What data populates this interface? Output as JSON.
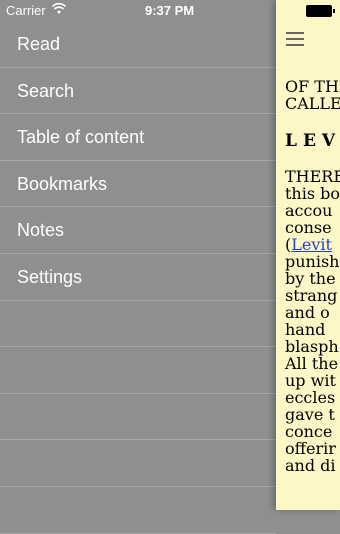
{
  "status_bar": {
    "carrier": "Carrier",
    "time": "9:37 PM",
    "wifi_icon": "wifi-icon",
    "battery_icon": "battery-icon"
  },
  "menu": {
    "items": [
      {
        "label": "Read"
      },
      {
        "label": "Search"
      },
      {
        "label": "Table of content"
      },
      {
        "label": "Bookmarks"
      },
      {
        "label": "Notes"
      },
      {
        "label": "Settings"
      }
    ]
  },
  "reader": {
    "menu_icon": "hamburger-menu-icon",
    "heading_lines": [
      "OF THE",
      "CALLE"
    ],
    "chapter": "LEV",
    "body_lines": [
      {
        "text": "THERE"
      },
      {
        "text": "this bo"
      },
      {
        "text": "accou"
      },
      {
        "text": "conse"
      },
      {
        "prefix": "(",
        "link": "Levit"
      },
      {
        "text": "punish"
      },
      {
        "text": "by the"
      },
      {
        "text": "strang"
      },
      {
        "text": "and o"
      },
      {
        "text": "hand"
      },
      {
        "text": "blasph"
      },
      {
        "text": "All the"
      },
      {
        "text": "up wit"
      },
      {
        "text": "eccles"
      },
      {
        "text": "gave t"
      },
      {
        "text": "conce"
      },
      {
        "text": "offerir"
      },
      {
        "text": "and di"
      }
    ],
    "background_color": "#fdf6c6",
    "link_color": "#2243c5"
  }
}
